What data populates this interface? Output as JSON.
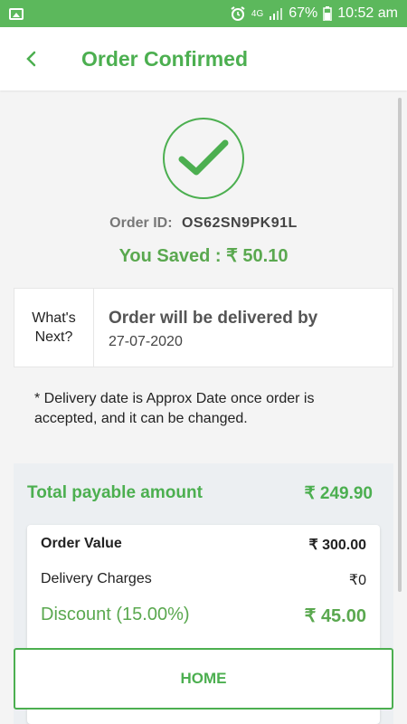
{
  "status_bar": {
    "network": "4G",
    "battery": "67%",
    "time": "10:52 am"
  },
  "header": {
    "title": "Order Confirmed"
  },
  "order": {
    "id_label": "Order ID:",
    "id_value": "OS62SN9PK91L",
    "saved_text": "You Saved : ₹ 50.10"
  },
  "next": {
    "label_line1": "What's",
    "label_line2": "Next?",
    "title": "Order will be delivered by",
    "date": "27-07-2020"
  },
  "note": "* Delivery date is Approx Date once order is accepted, and it can be changed.",
  "payment": {
    "total_label": "Total payable amount",
    "total_value": "₹ 249.90",
    "rows": [
      {
        "label": "Order Value",
        "value": "₹ 300.00"
      },
      {
        "label": "Delivery Charges",
        "value": "₹0"
      },
      {
        "label": "Discount (15.00%)",
        "value": "₹ 45.00"
      }
    ]
  },
  "footer": {
    "home_label": "HOME"
  },
  "colors": {
    "accent": "#4caf50",
    "status_bar": "#5cb85c"
  }
}
